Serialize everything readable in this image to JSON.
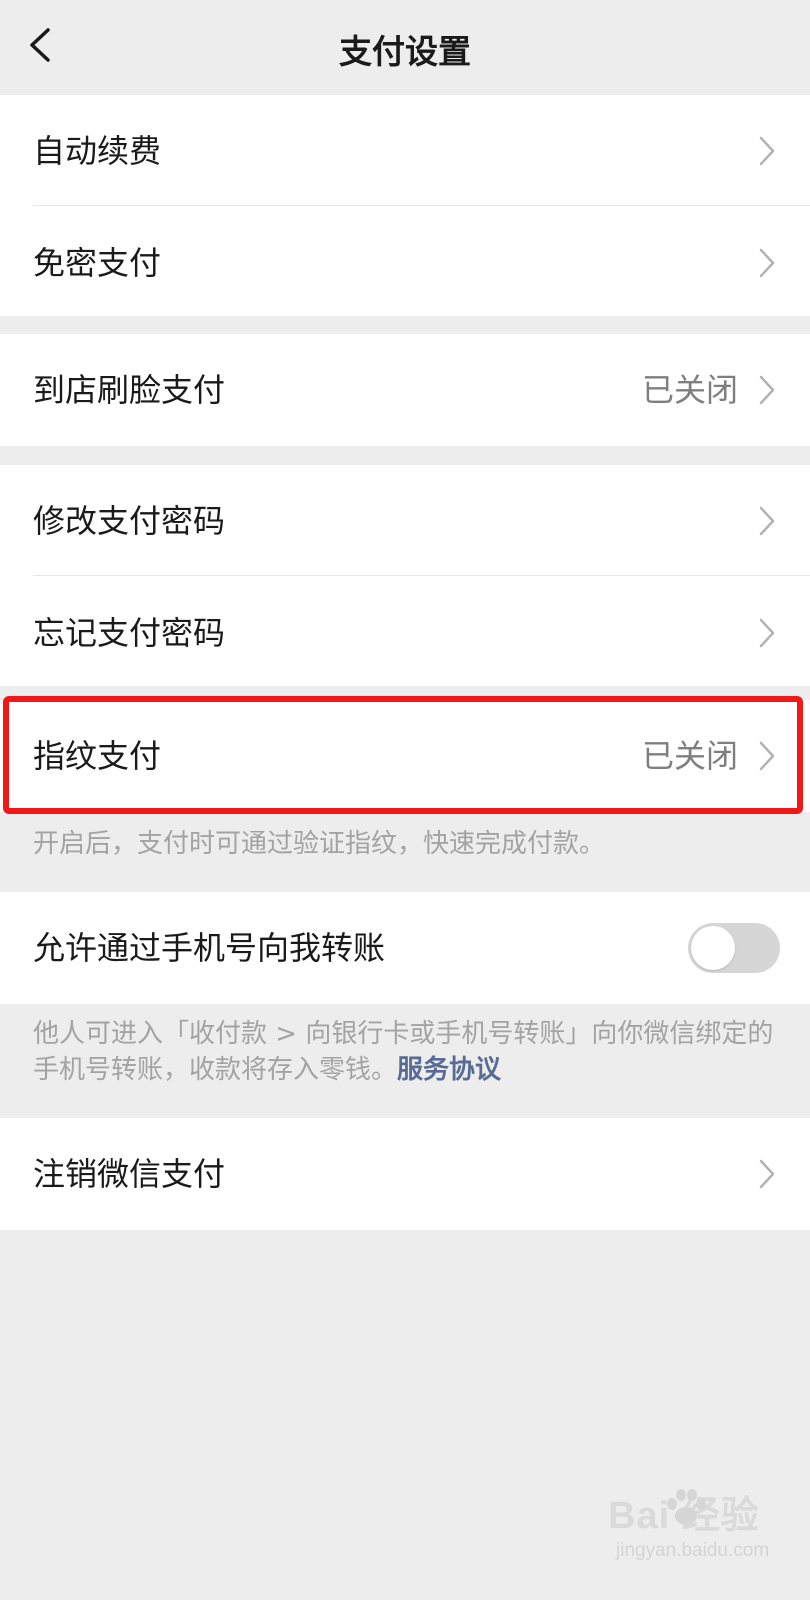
{
  "header": {
    "title": "支付设置",
    "back_icon": "chevron-left-icon"
  },
  "groups": {
    "g1": {
      "items": [
        {
          "label": "自动续费"
        },
        {
          "label": "免密支付"
        }
      ]
    },
    "g2": {
      "items": [
        {
          "label": "到店刷脸支付",
          "value": "已关闭"
        }
      ]
    },
    "g3": {
      "items": [
        {
          "label": "修改支付密码"
        },
        {
          "label": "忘记支付密码"
        }
      ]
    },
    "g4": {
      "items": [
        {
          "label": "指纹支付",
          "value": "已关闭"
        }
      ],
      "description": "开启后，支付时可通过验证指纹，快速完成付款。",
      "highlight_color": "#f21818"
    },
    "g5": {
      "items": [
        {
          "label": "允许通过手机号向我转账",
          "toggle_on": false
        }
      ],
      "description_part1": "他人可进入「收付款 > 向银行卡或手机号转账」向你微信绑定的手机号转账，收款将存入零钱。",
      "description_link": "服务协议",
      "link_color": "#576b95"
    },
    "g6": {
      "items": [
        {
          "label": "注销微信支付"
        }
      ]
    }
  },
  "watermark": {
    "logo_text": "Bai  经验",
    "sub_text": "jingyan.baidu.com"
  },
  "colors": {
    "background": "#ededed",
    "card": "#ffffff",
    "secondary_text": "#7f7f7f",
    "toggle_off": "#d6d6d6"
  }
}
